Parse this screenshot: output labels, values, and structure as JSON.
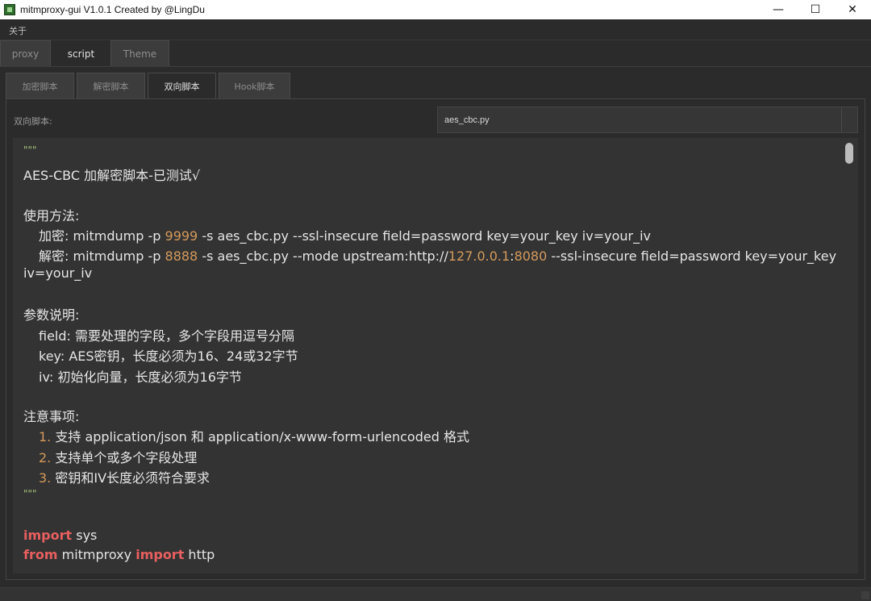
{
  "window": {
    "title": "mitmproxy-gui V1.0.1 Created by @LingDu",
    "controls": {
      "minimize": "—",
      "maximize": "☐",
      "close": "✕"
    }
  },
  "menu": {
    "items": [
      "关于"
    ]
  },
  "main_tabs": [
    "proxy",
    "script",
    "Theme"
  ],
  "main_tab_active": "script",
  "sub_tabs": [
    "加密脚本",
    "解密脚本",
    "双向脚本",
    "Hook脚本"
  ],
  "sub_tab_active": "双向脚本",
  "script_label": "双向脚本:",
  "script_select": {
    "value": "aes_cbc.py"
  },
  "code": {
    "doc_open": "\"\"\"",
    "title": "AES-CBC 加解密脚本-已测试√",
    "usage_header": "使用方法:",
    "usage_enc": {
      "prefix": "加密: mitmdump -p ",
      "port": "9999",
      "suffix": " -s aes_cbc.py --ssl-insecure field=password key=your_key iv=your_iv"
    },
    "usage_dec": {
      "prefix": "解密: mitmdump -p ",
      "port": "8888",
      "mid": " -s aes_cbc.py --mode upstream:http://",
      "ip": "127.0.0.1",
      "colon": ":",
      "port2": "8080",
      "suffix": " --ssl-insecure field=password key=your_key"
    },
    "usage_dec_wrap": "iv=your_iv",
    "params_header": "参数说明:",
    "param_field": "field: 需要处理的字段，多个字段用逗号分隔",
    "param_key": "key: AES密钥，长度必须为16、24或32字节",
    "param_iv": "iv: 初始化向量，长度必须为16字节",
    "notes_header": "注意事项:",
    "notes": [
      {
        "num": "1.",
        "text": " 支持 application/json 和 application/x-www-form-urlencoded 格式"
      },
      {
        "num": "2.",
        "text": " 支持单个或多个字段处理"
      },
      {
        "num": "3.",
        "text": " 密钥和IV长度必须符合要求"
      }
    ],
    "doc_close": "\"\"\"",
    "import_kw": "import",
    "import_rest": " sys",
    "from_kw": "from",
    "from_mid": " mitmproxy ",
    "from_import_kw": "import",
    "from_rest": " http"
  }
}
